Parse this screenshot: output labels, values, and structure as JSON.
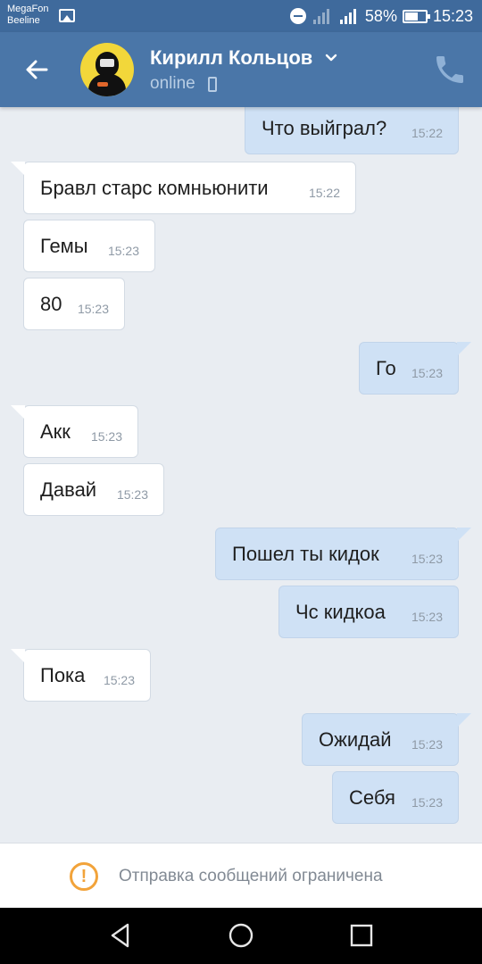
{
  "status_bar": {
    "carrier_1": "MegaFon",
    "carrier_2": "Beeline",
    "battery": "58%",
    "time": "15:23",
    "icons": [
      "gallery-icon",
      "dnd-icon",
      "signal-icon",
      "signal-icon",
      "battery-icon"
    ]
  },
  "header": {
    "contact_name": "Кирилл Кольцов",
    "presence": "online",
    "icons": [
      "back-arrow-icon",
      "chevron-down-icon",
      "mobile-icon",
      "phone-icon"
    ],
    "colors": {
      "header_bg": "#4a76a8",
      "status_bg": "#3f6a9c"
    }
  },
  "messages": [
    {
      "direction": "out",
      "text": "Что выйграл?",
      "time": "15:22"
    },
    {
      "direction": "in",
      "text": "Бравл старс комньюнити",
      "time": "15:22"
    },
    {
      "direction": "in",
      "text": "Гемы",
      "time": "15:23"
    },
    {
      "direction": "in",
      "text": "80",
      "time": "15:23"
    },
    {
      "direction": "out",
      "text": "Го",
      "time": "15:23"
    },
    {
      "direction": "in",
      "text": "Акк",
      "time": "15:23"
    },
    {
      "direction": "in",
      "text": "Давай",
      "time": "15:23"
    },
    {
      "direction": "out",
      "text": "Пошел ты кидок",
      "time": "15:23"
    },
    {
      "direction": "out",
      "text": "Чс кидкоа",
      "time": "15:23"
    },
    {
      "direction": "in",
      "text": "Пока",
      "time": "15:23"
    },
    {
      "direction": "out",
      "text": "Ожидай",
      "time": "15:23"
    },
    {
      "direction": "out",
      "text": "Себя",
      "time": "15:23"
    }
  ],
  "footer": {
    "restriction_text": "Отправка сообщений ограничена",
    "icon": "warning-icon",
    "warning_color": "#f2a33a"
  },
  "nav_bar": {
    "icons": [
      "back-triangle-icon",
      "home-circle-icon",
      "recents-square-icon"
    ]
  }
}
